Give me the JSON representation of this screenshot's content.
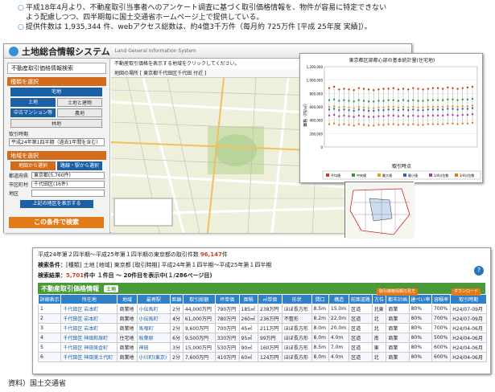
{
  "banner": {
    "line1": "平成18年4月より、不動産取引当事者へのアンケート調査に基づく取引価格情報を、物件が容易に特定できない",
    "line2": "よう配慮しつつ、四半期毎に国土交通省ホームページ上で提供している。",
    "line3": "提供件数は 1,935,344 件、webアクセス総数は、約4億3千万件（毎月約 725万件 [平成 25年度 実績]）。"
  },
  "window": {
    "title": "土地総合情報システム",
    "subtitle": "Land General Information System",
    "instructions": "不動産取引価格を表示する地域をクリックしてください。",
    "location": "地図の場所 [ 東京都千代田区千代田 付近 ]"
  },
  "sidebar": {
    "panel_title": "不動産取引価格情報検索",
    "step1": "種類を選択",
    "types": [
      "宅地",
      "土地",
      "土地と建物",
      "中古マンション等",
      "農地",
      "林地"
    ],
    "period_label": "取引時期",
    "period_value": "平成24年第1四半期（過去1年間を含む）",
    "step2": "地域を選択",
    "area_tabs": [
      "地図から選択",
      "路線・駅から選択"
    ],
    "pref_label": "都道府県",
    "pref_value": "東京都(5,760件)",
    "city_label": "市区町村",
    "city_value": "千代田区(16件)",
    "district_label": "地区",
    "district_value": "",
    "list_button": "上記の地区を表示する",
    "search_button": "この条件で検索"
  },
  "chart": {
    "title": "東京都区部都心部の基本統計量(住宅地)",
    "ylabel": "価格（円/㎡）",
    "xlabel": "取引時点",
    "legend": [
      "平均値",
      "中央値",
      "最大値",
      "最小値",
      "1/4分位数",
      "3/4分位数"
    ]
  },
  "chart_data": {
    "type": "scatter",
    "title": "東京都区部都心部の基本統計量(住宅地)",
    "xlabel": "取引時点",
    "ylabel": "価格（円/㎡）",
    "ylim": [
      0,
      1200000
    ],
    "x": [
      1,
      2,
      3,
      4,
      5,
      6,
      7,
      8,
      9,
      10,
      11,
      12,
      13,
      14,
      15,
      16,
      17,
      18,
      19,
      20,
      21,
      22,
      23,
      24,
      25,
      26,
      27,
      28,
      29,
      30
    ],
    "series": [
      {
        "name": "最大値",
        "values": [
          880000,
          900000,
          860000,
          870000,
          860000,
          850000,
          880000,
          870000,
          860000,
          850000,
          860000,
          870000,
          870000,
          880000,
          860000,
          870000,
          860000,
          880000,
          870000,
          860000,
          870000,
          880000,
          880000,
          870000,
          890000,
          880000,
          870000,
          880000,
          890000,
          900000
        ]
      },
      {
        "name": "3/4分位数",
        "values": [
          700000,
          710000,
          690000,
          700000,
          690000,
          680000,
          700000,
          690000,
          680000,
          680000,
          690000,
          690000,
          700000,
          700000,
          690000,
          700000,
          690000,
          700000,
          690000,
          690000,
          700000,
          700000,
          700000,
          700000,
          710000,
          710000,
          700000,
          710000,
          710000,
          720000
        ]
      },
      {
        "name": "平均値",
        "values": [
          600000,
          610000,
          590000,
          600000,
          590000,
          580000,
          600000,
          590000,
          580000,
          580000,
          590000,
          590000,
          600000,
          600000,
          590000,
          600000,
          590000,
          600000,
          590000,
          590000,
          600000,
          600000,
          600000,
          600000,
          610000,
          610000,
          600000,
          610000,
          610000,
          620000
        ]
      },
      {
        "name": "中央値",
        "values": [
          560000,
          570000,
          550000,
          560000,
          550000,
          540000,
          560000,
          550000,
          540000,
          540000,
          550000,
          550000,
          560000,
          560000,
          550000,
          560000,
          550000,
          560000,
          550000,
          550000,
          560000,
          560000,
          560000,
          560000,
          570000,
          570000,
          560000,
          570000,
          570000,
          580000
        ]
      },
      {
        "name": "1/4分位数",
        "values": [
          470000,
          480000,
          460000,
          470000,
          460000,
          450000,
          470000,
          460000,
          450000,
          450000,
          460000,
          460000,
          470000,
          470000,
          460000,
          470000,
          460000,
          470000,
          460000,
          460000,
          470000,
          470000,
          470000,
          470000,
          480000,
          480000,
          470000,
          480000,
          480000,
          490000
        ]
      },
      {
        "name": "最小値",
        "values": [
          340000,
          350000,
          330000,
          340000,
          330000,
          320000,
          340000,
          330000,
          320000,
          320000,
          330000,
          330000,
          340000,
          340000,
          330000,
          340000,
          330000,
          340000,
          330000,
          330000,
          340000,
          340000,
          340000,
          340000,
          350000,
          350000,
          340000,
          350000,
          350000,
          360000
        ]
      }
    ],
    "colors": [
      "#d03a1a",
      "#2a9a3a",
      "#e0a020",
      "#3060c0",
      "#a040a0",
      "#e07a1a"
    ]
  },
  "results": {
    "summary_prefix": "平成24年第２四半期〜平成25年第１四半期の東京都の取引件数",
    "summary_count": "96,147",
    "summary_unit": "件",
    "conditions_label": "検索条件：",
    "conditions_value": "[種類] 土地 [地域] 東京都 [取引時期] 平成24年第１四半期〜平成25年第１四半期",
    "result_label": "検索結果：",
    "result_count": "5,701",
    "result_rest": "件中 １件目 〜 20件目を表示中(１/286ページ目)",
    "tab_title": "不動産取引価格情報",
    "tab_chip": "土地",
    "help": "?",
    "dl_buttons": [
      "取引価格情報の見方",
      "ダウンロード"
    ],
    "headers": [
      "詳細表示",
      "所在地",
      "地域",
      "最寄駅",
      "距離",
      "取引総額",
      "坪単価",
      "面積",
      "㎡単価",
      "形状",
      "間口",
      "構造",
      "前面道路",
      "方位",
      "都市計画",
      "建ぺい率",
      "容積率",
      "取引時期"
    ],
    "rows": [
      [
        "1",
        "千代田区 岩本町",
        "商業地",
        "小伝馬町",
        "2分",
        "44,000万円",
        "790万円",
        "185㎡",
        "238万円",
        "ほぼ長方形",
        "8.5m",
        "15.0m",
        "区道",
        "北東",
        "商業",
        "80%",
        "700%",
        "H24/07-09月"
      ],
      [
        "2",
        "千代田区 岩本町",
        "商業地",
        "小伝馬町",
        "4分",
        "61,000万円",
        "780万円",
        "260㎡",
        "236万円",
        "不整形",
        "8.2m",
        "22.0m",
        "区道",
        "北",
        "商業",
        "80%",
        "700%",
        "H24/07-09月"
      ],
      [
        "3",
        "千代田区 岩本町",
        "商業地",
        "馬喰町",
        "2分",
        "9,600万円",
        "700万円",
        "45㎡",
        "211万円",
        "ほぼ長方形",
        "8.0m",
        "20.0m",
        "区道",
        "北",
        "商業",
        "80%",
        "700%",
        "H24/04-06月"
      ],
      [
        "4",
        "千代田区 神田和泉町",
        "住宅地",
        "秋葉原",
        "6分",
        "9,500万円",
        "330万円",
        "95㎡",
        "99万円",
        "ほぼ長方形",
        "8.0m",
        "4.0m",
        "区道",
        "南",
        "商業",
        "80%",
        "500%",
        "H24/04-06月"
      ],
      [
        "5",
        "千代田区 神田美倉町",
        "商業地",
        "神田",
        "3分",
        "15,000万円",
        "530万円",
        "90㎡",
        "160万円",
        "ほぼ長方形",
        "8.5m",
        "7.0m",
        "区道",
        "東",
        "商業",
        "80%",
        "600%",
        "H24/04-06月"
      ],
      [
        "6",
        "千代田区 神田美土代町",
        "商業地",
        "小川町(東京)",
        "2分",
        "7,600万円",
        "410万円",
        "60㎡",
        "124万円",
        "ほぼ長方形",
        "8.0m",
        "4.0m",
        "区道",
        "北",
        "商業",
        "80%",
        "600%",
        "H24/04-06月"
      ]
    ]
  },
  "source": "資料）国土交通省"
}
